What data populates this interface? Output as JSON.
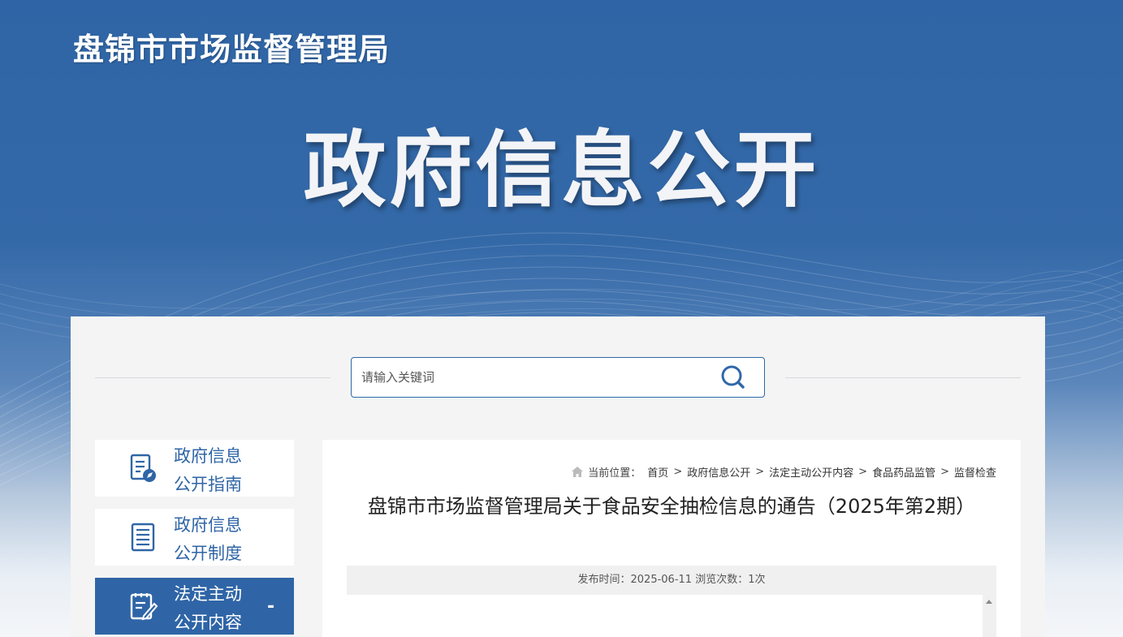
{
  "header": {
    "site_name": "盘锦市市场监督管理局",
    "banner_title": "政府信息公开"
  },
  "search": {
    "placeholder": "请输入关键词",
    "icon": "search-icon"
  },
  "sidebar": {
    "items": [
      {
        "line1": "政府信息",
        "line2": "公开指南",
        "icon": "guide-document-icon",
        "active": false
      },
      {
        "line1": "政府信息",
        "line2": "公开制度",
        "icon": "list-document-icon",
        "active": false
      },
      {
        "line1": "法定主动",
        "line2": "公开内容",
        "icon": "edit-document-icon",
        "active": true,
        "toggle": "-"
      }
    ]
  },
  "breadcrumb": {
    "prefix": "当前位置：",
    "items": [
      "首页",
      "政府信息公开",
      "法定主动公开内容",
      "食品药品监管",
      "监督检查"
    ],
    "separator": ">"
  },
  "article": {
    "title": "盘锦市市场监督管理局关于食品安全抽检信息的通告（2025年第2期）",
    "meta": "发布时间：2025-06-11 浏览次数：1次"
  },
  "colors": {
    "brand": "#2f65a6",
    "panel_bg": "#f4f4f4"
  }
}
